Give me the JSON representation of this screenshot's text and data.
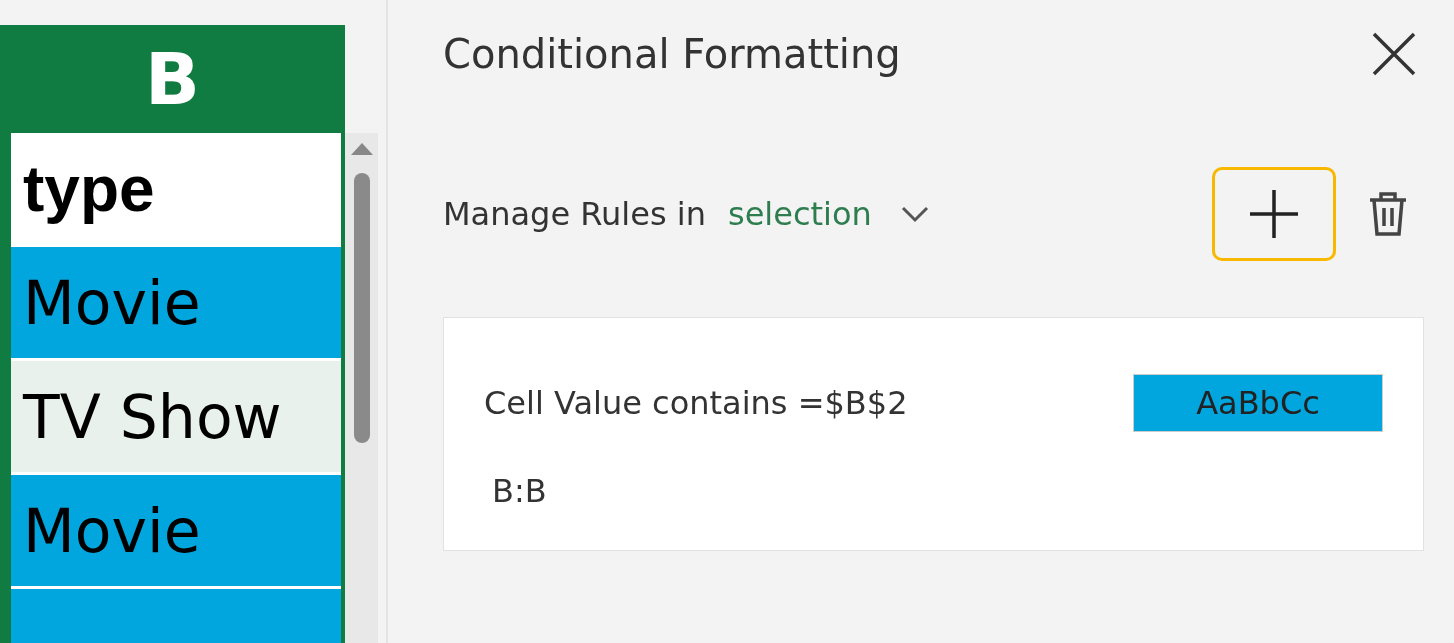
{
  "sheet": {
    "column_header": "B",
    "rows": [
      {
        "text": "type",
        "kind": "header",
        "highlighted": false
      },
      {
        "text": "Movie",
        "kind": "value",
        "highlighted": true
      },
      {
        "text": "TV Show",
        "kind": "value",
        "highlighted": false
      },
      {
        "text": "Movie",
        "kind": "value",
        "highlighted": true
      },
      {
        "kind": "value",
        "highlighted": true
      }
    ]
  },
  "panel": {
    "title": "Conditional Formatting",
    "manage_label": "Manage Rules in",
    "scope": "selection",
    "add_button": {
      "focused": true
    },
    "rules": [
      {
        "condition": "Cell Value contains =$B$2",
        "preview": "AaBbCc",
        "color": "#00a6dd",
        "applies_to": "B:B"
      }
    ]
  }
}
